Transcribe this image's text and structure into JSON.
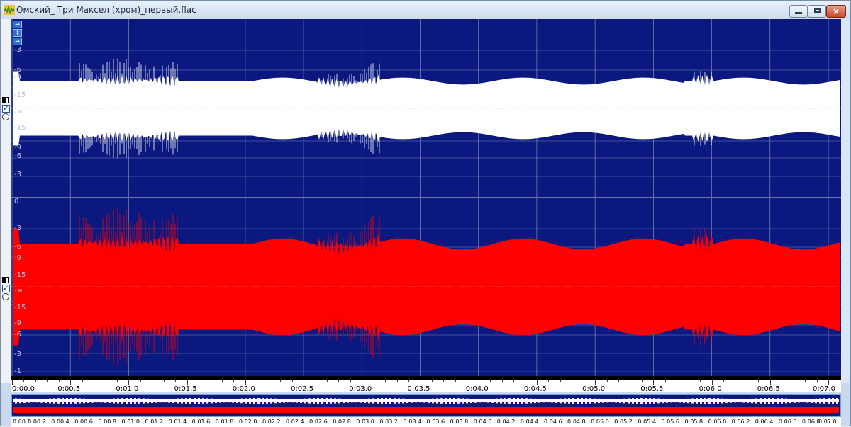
{
  "window": {
    "title": "Омский_ Три Максел (хром)_первый.flac",
    "minimize_label": "",
    "maximize_label": "",
    "close_label": "×"
  },
  "colors": {
    "plot_bg": "#0a1880",
    "channel1_wave": "#ffffff",
    "channel2_wave": "#ff0000",
    "grid": "#7f8ab8"
  },
  "channel1": {
    "db_labels": [
      "-3",
      "-6",
      "-9",
      "-15",
      "-∞",
      "-15",
      "-9",
      "-6",
      "-3"
    ]
  },
  "channel2": {
    "db_labels": [
      "0",
      "-3",
      "-6",
      "-9",
      "-15",
      "-∞",
      "-15",
      "-9",
      "-6",
      "-3",
      "-1"
    ]
  },
  "tools": {
    "zoom_h_icon": "horizontal-zoom-icon",
    "zoom_v_icon": "vertical-zoom-icon",
    "fit_icon": "fit-icon"
  },
  "timeline": {
    "labels": [
      "0:00.0",
      "0:00.5",
      "0:01.0",
      "0:01.5",
      "0:02.0",
      "0:02.5",
      "0:03.0",
      "0:03.5",
      "0:04.0",
      "0:04.5",
      "0:05.0",
      "0:05.5",
      "0:06.0",
      "0:06.5",
      "0:07.0"
    ]
  },
  "overview_timeline": {
    "labels": [
      "0:00.0",
      "0:00.2",
      "0:00.4",
      "0:00.6",
      "0:00.8",
      "0:01.0",
      "0:01.2",
      "0:01.4",
      "0:01.6",
      "0:01.8",
      "0:02.0",
      "0:02.2",
      "0:02.4",
      "0:02.6",
      "0:02.8",
      "0:03.0",
      "0:03.2",
      "0:03.4",
      "0:03.6",
      "0:03.8",
      "0:04.0",
      "0:04.2",
      "0:04.4",
      "0:04.6",
      "0:04.8",
      "0:05.0",
      "0:05.2",
      "0:05.4",
      "0:05.6",
      "0:05.8",
      "0:06.0",
      "0:06.2",
      "0:06.4",
      "0:06.6",
      "0:06.8",
      "0:07.0"
    ]
  }
}
